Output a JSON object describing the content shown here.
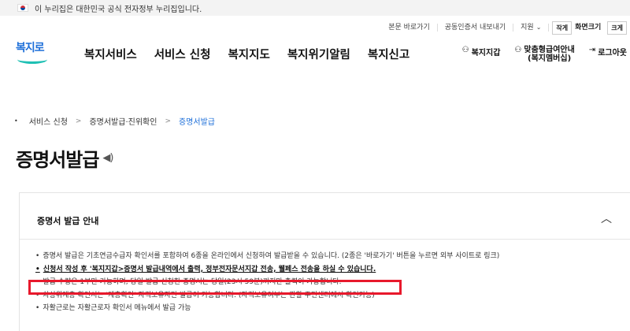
{
  "gov_banner": {
    "text": "이 누리집은 대한민국 공식 전자정부 누리집입니다."
  },
  "utility": {
    "shortcut": "본문 바로가기",
    "cert": "공동인증서 내보내기",
    "support": "지원",
    "size_small": "작게",
    "size_label": "화면크기",
    "size_large": "크게"
  },
  "header": {
    "logo_text": "복지로",
    "nav": [
      "복지서비스",
      "서비스 신청",
      "복지지도",
      "복지위기알림",
      "복지신고"
    ],
    "my_welfare": "복지지갑",
    "custom_info_line1": "맞춤형급여안내",
    "custom_info_line2": "(복지멤버십)",
    "logout": "로그아웃"
  },
  "breadcrumb": {
    "items": [
      "서비스 신청",
      "증명서발급·진위확인",
      "증명서발급"
    ]
  },
  "page": {
    "title": "증명서발급"
  },
  "panel": {
    "heading": "증명서 발급 안내",
    "lines": [
      "증명서 발급은 기초연금수급자 확인서를 포함하여 6종을 온라인에서 신청하여 발급받을 수 있습니다. (2종은 '바로가기' 버튼을 누르면 외부 사이트로 링크)",
      "신청서 작성 후 '복지지갑>증명서 발급내역에서 출력, 정부전자문서지갑 전송, 웰페스 전송을 하실 수 있습니다.",
      "발급 수량은 1부만 가능하며, 당일 발급 신청한 증명서는 당일(23시 59분)까지만 출력이 가능합니다.",
      "차상위계층 확인서는 '계층확인' 자격보유자만 발급이 가능합니다. (자격보유여부는 관할 주민센터에서 확인가능)",
      "자활근로는 자활근로자 확인서 메뉴에서 발급 가능"
    ]
  }
}
